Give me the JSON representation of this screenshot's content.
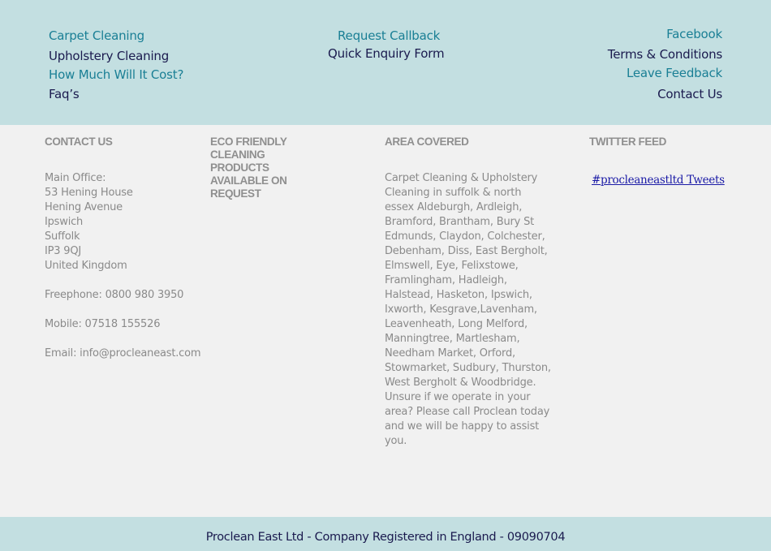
{
  "nav": {
    "left": [
      "Carpet Cleaning",
      "Upholstery Cleaning",
      "How Much Will It Cost?",
      "Faq’s"
    ],
    "center": [
      "Request Callback",
      "Quick Enquiry Form"
    ],
    "right": [
      "Facebook",
      "Terms & Conditions",
      "Leave Feedback",
      "Contact Us"
    ]
  },
  "contact": {
    "heading": "CONTACT US",
    "address": [
      "Main Office:",
      "53 Hening House",
      "Hening Avenue",
      "Ipswich",
      "Suffolk",
      "IP3 9QJ",
      "United Kingdom"
    ],
    "freephone": "Freephone: 0800 980 3950",
    "mobile": "Mobile: 07518 155526",
    "email": "Email: info@procleaneast.com"
  },
  "eco": {
    "heading_lines": [
      "ECO FRIENDLY",
      "CLEANING",
      "PRODUCTS",
      "AVAILABLE ON",
      "REQUEST"
    ]
  },
  "area": {
    "heading": "AREA COVERED",
    "lines": [
      "Carpet Cleaning & Upholstery",
      "Cleaning in suffolk & north",
      "essex Aldeburgh, Ardleigh,",
      "Bramford, Brantham, Bury St",
      "Edmunds, Claydon, Colchester,",
      "Debenham, Diss, East Bergholt,",
      "Elmswell, Eye, Felixstowe,",
      "Framlingham, Hadleigh,",
      "Halstead, Hasketon, Ipswich,",
      "Ixworth, Kesgrave,Lavenham,",
      "Leavenheath, Long Melford,",
      "Manningtree, Martlesham,",
      "Needham Market, Orford,",
      "Stowmarket, Sudbury, Thurston,",
      "West Bergholt & Woodbridge.",
      "Unsure if we operate in your",
      "area? Please call Proclean today",
      "and we will be happy to assist",
      "you."
    ]
  },
  "twitter": {
    "heading": "TWITTER FEED",
    "link": "#procleaneastltd Tweets"
  },
  "footer": {
    "text": "Proclean East Ltd - Company Registered in England - 09090704"
  },
  "colors": {
    "band": "#c3dfe1",
    "background": "#f1f1f1",
    "link_teal": "#1a7f95",
    "link_navy": "#1a1a4e",
    "muted_text": "#8a8a8a"
  }
}
